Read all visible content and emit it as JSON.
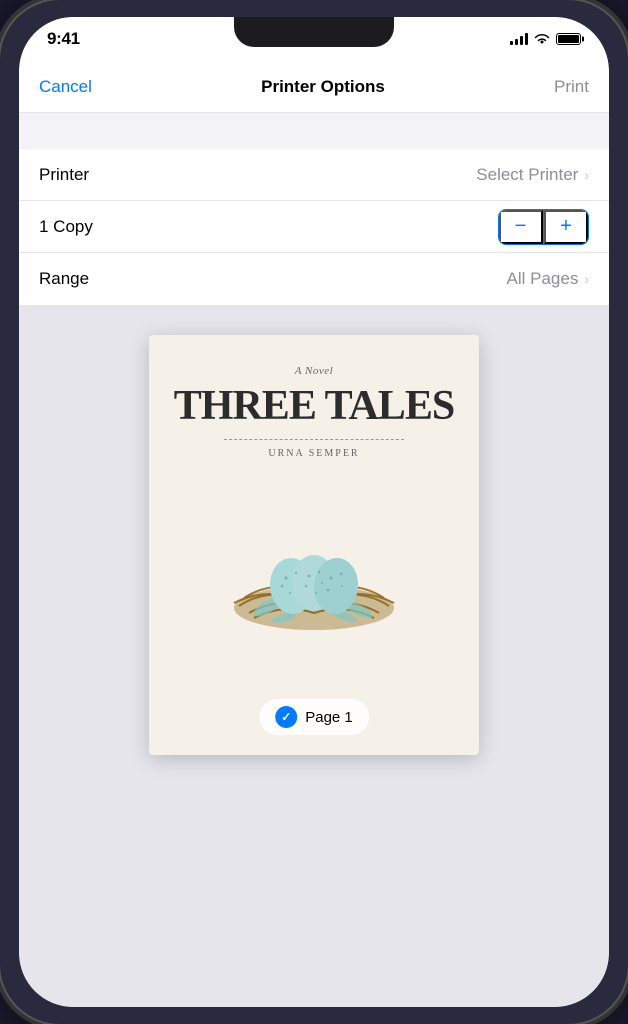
{
  "status_bar": {
    "time": "9:41"
  },
  "nav": {
    "cancel_label": "Cancel",
    "title": "Printer Options",
    "print_label": "Print"
  },
  "options": {
    "printer_label": "Printer",
    "printer_value": "Select Printer",
    "copies_label": "1 Copy",
    "minus_label": "−",
    "plus_label": "+",
    "range_label": "Range",
    "range_value": "All Pages"
  },
  "book": {
    "subtitle": "A Novel",
    "title": "THREE TALES",
    "author": "URNA SEMPER"
  },
  "page_badge": {
    "label": "Page 1"
  }
}
